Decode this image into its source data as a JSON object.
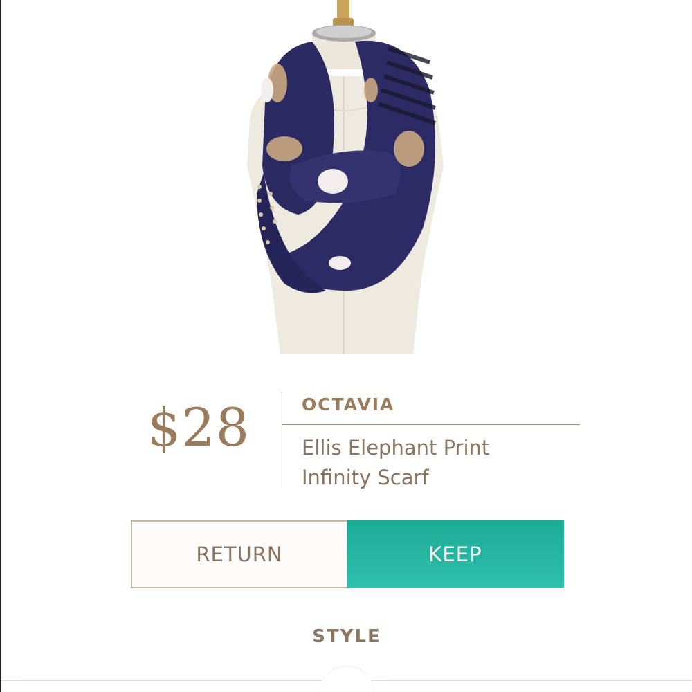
{
  "product": {
    "price": "$28",
    "brand": "OCTAVIA",
    "name_line1": "Ellis Elephant Print",
    "name_line2": "Infinity Scarf",
    "image_icon": "scarf-on-mannequin-image"
  },
  "actions": {
    "return_label": "RETURN",
    "keep_label": "KEEP"
  },
  "section": {
    "title": "STYLE"
  },
  "colors": {
    "accent_brown": "#9a7c5c",
    "keep_teal": "#1cab97",
    "scarf_navy": "#2b2a63"
  }
}
